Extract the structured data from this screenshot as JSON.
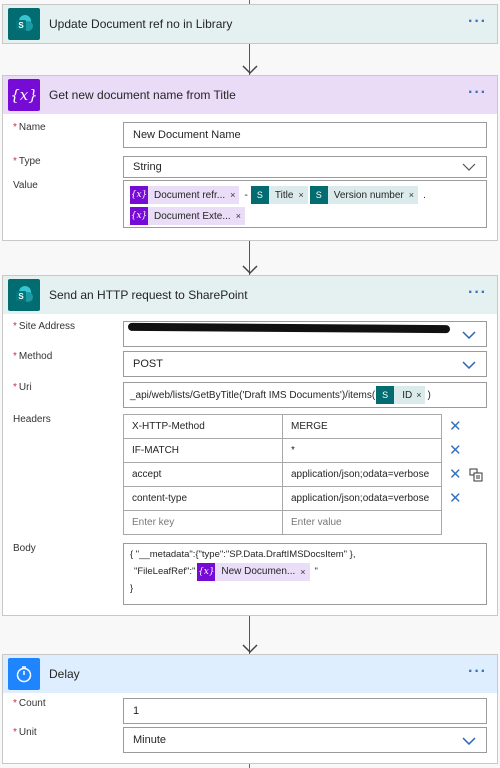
{
  "update_card": {
    "title": "Update Document ref no in Library"
  },
  "var_card": {
    "title": "Get new document name from Title",
    "name_label": "Name",
    "name_value": "New Document Name",
    "type_label": "Type",
    "type_value": "String",
    "value_label": "Value",
    "tokens": {
      "t1": "Document refr...",
      "sep1": "-",
      "t2": "Title",
      "t3": "Version number",
      "sep2": ".",
      "t4": "Document Exte..."
    }
  },
  "http_card": {
    "title": "Send an HTTP request to SharePoint",
    "site_label": "Site Address",
    "method_label": "Method",
    "method_value": "POST",
    "uri_label": "Uri",
    "uri_prefix": "_api/web/lists/GetByTitle('Draft IMS Documents')/items(",
    "uri_token": "ID",
    "uri_suffix": ")",
    "headers_label": "Headers",
    "headers": [
      {
        "key": "X-HTTP-Method",
        "value": "MERGE"
      },
      {
        "key": "IF-MATCH",
        "value": "*"
      },
      {
        "key": "accept",
        "value": "application/json;odata=verbose"
      },
      {
        "key": "content-type",
        "value": "application/json;odata=verbose"
      }
    ],
    "key_placeholder": "Enter key",
    "value_placeholder": "Enter value",
    "body_label": "Body",
    "body_line1": "{ \"__metadata\":{\"type\":\"SP.Data.DraftIMSDocsItem\" },",
    "body_line2_prefix": "\"FileLeafRef\":\"",
    "body_token": "New Documen...",
    "body_line2_suffix": "\"",
    "body_line3": "}"
  },
  "delay_card": {
    "title": "Delay",
    "count_label": "Count",
    "count_value": "1",
    "unit_label": "Unit",
    "unit_value": "Minute"
  },
  "ui": {
    "more": "···",
    "required": "*",
    "remove": "×",
    "delete": "✕"
  },
  "colors": {
    "sharepoint": "#036c70",
    "variable": "#770bd6",
    "delay": "#1f85ff",
    "accent": "#3a74c0"
  }
}
